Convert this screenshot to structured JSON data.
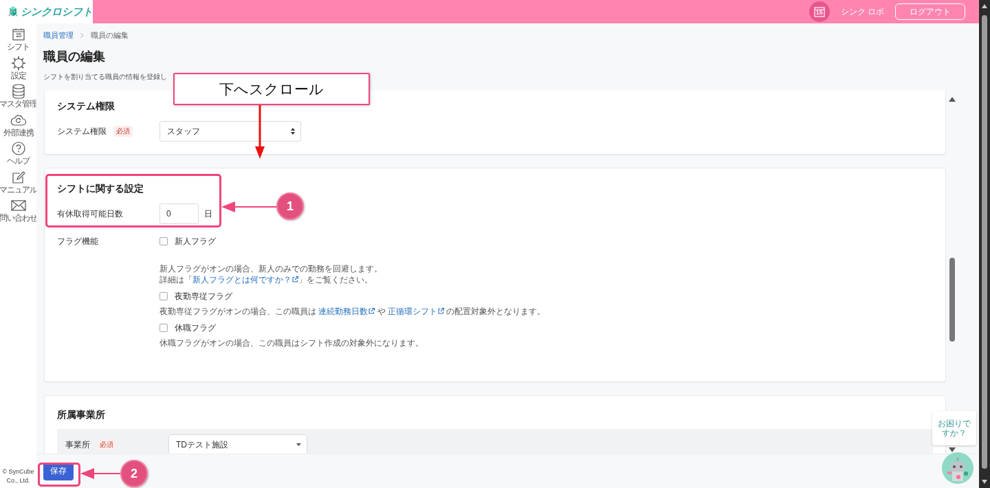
{
  "header": {
    "logo_text": "シンクロシフト",
    "calendar_day": "15",
    "user_name": "シンク ロボ",
    "logout_button": "ログアウト"
  },
  "sidebar": {
    "items": [
      {
        "label": "シフト",
        "icon_text": "15"
      },
      {
        "label": "設定"
      },
      {
        "label": "マスタ管理"
      },
      {
        "label": "外部連携"
      },
      {
        "label": "ヘルプ"
      },
      {
        "label": "マニュアル"
      },
      {
        "label": "問い合わせ"
      }
    ],
    "copyright": "© SynCube Co., Ltd."
  },
  "breadcrumb": [
    {
      "label": "職員管理",
      "link": true
    },
    {
      "label": "職員の編集",
      "link": false
    }
  ],
  "page_title": "職員の編集",
  "description": "シフトを割り当てる職員の情報を登録し",
  "sections": [
    {
      "title": "システム権限",
      "fields": [
        {
          "kind": "select",
          "label": "システム権限",
          "required": "必須",
          "value": "スタッフ"
        }
      ]
    },
    {
      "title": "シフトに関する設定",
      "fields": [
        {
          "kind": "number",
          "label": "有休取得可能日数",
          "value": "0",
          "unit": "日"
        },
        {
          "kind": "flags",
          "label": "フラグ機能",
          "options": [
            {
              "label": "新人フラグ",
              "checked": false,
              "notes": [
                [
                  {
                    "text": "新人フラグがオンの場合、新人のみでの勤務を回避します。"
                  }
                ],
                [
                  {
                    "text": "詳細は「"
                  },
                  {
                    "text": "新人フラグとは何ですか？",
                    "link": true
                  },
                  {
                    "text": "」をご覧ください。"
                  }
                ]
              ]
            },
            {
              "label": "夜勤専従フラグ",
              "checked": false,
              "notes": [
                [
                  {
                    "text": "夜勤専従フラグがオンの場合、この職員は "
                  },
                  {
                    "text": "連続勤務日数",
                    "link": true
                  },
                  {
                    "text": " や "
                  },
                  {
                    "text": "正循環シフト",
                    "link": true
                  },
                  {
                    "text": " の配置対象外となります。"
                  }
                ]
              ]
            },
            {
              "label": "休職フラグ",
              "checked": false,
              "notes": [
                [
                  {
                    "text": "休職フラグがオンの場合、この職員はシフト作成の対象外になります。"
                  }
                ]
              ]
            }
          ]
        }
      ]
    },
    {
      "title": "所属事業所",
      "fields": [
        {
          "kind": "dropdown",
          "label": "事業所",
          "required": "必須",
          "value": "TDテスト施設"
        }
      ]
    }
  ],
  "footer": {
    "save_button": "保存"
  },
  "help": {
    "bubble": "お困りですか？"
  },
  "annotations": {
    "callout": "下へスクロール",
    "markers": [
      {
        "number": "1"
      },
      {
        "number": "2"
      }
    ]
  }
}
